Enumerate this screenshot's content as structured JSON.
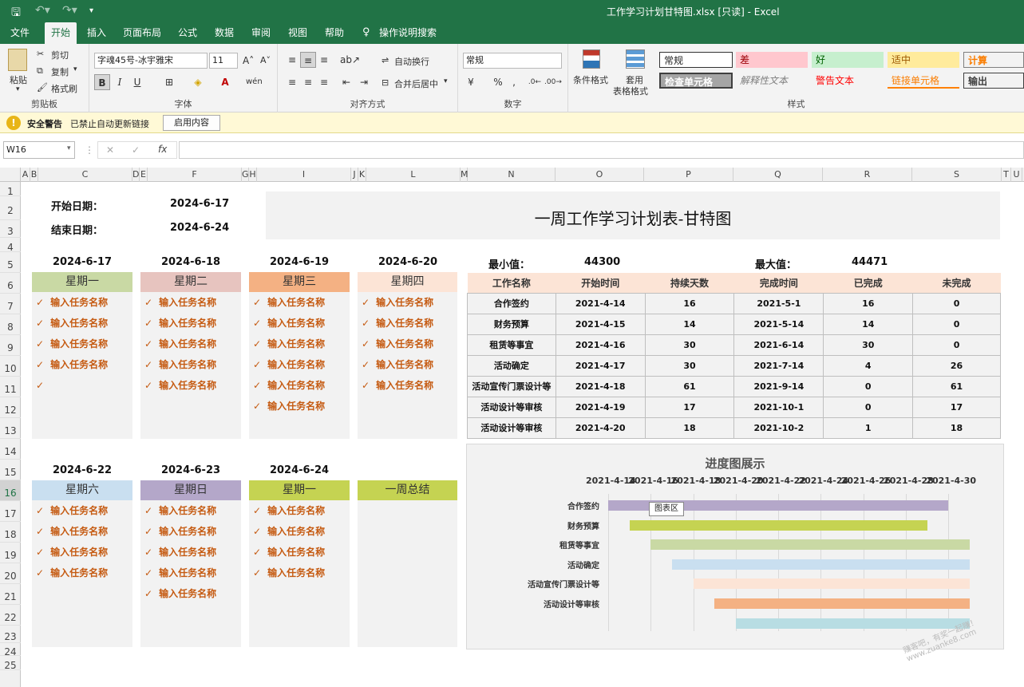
{
  "window": {
    "title": "工作学习计划甘特图.xlsx  [只读]  -  Excel"
  },
  "menu": {
    "tabs": [
      "文件",
      "开始",
      "插入",
      "页面布局",
      "公式",
      "数据",
      "审阅",
      "视图",
      "帮助",
      "操作说明搜索"
    ]
  },
  "ribbon": {
    "clipboard": {
      "paste": "粘贴",
      "cut": "剪切",
      "copy": "复制",
      "format_painter": "格式刷",
      "label": "剪贴板"
    },
    "font": {
      "name": "字魂45号-冰宇雅宋",
      "size": "11",
      "label": "字体"
    },
    "alignment": {
      "wrap": "自动换行",
      "merge": "合并后居中",
      "label": "对齐方式"
    },
    "number": {
      "format": "常规",
      "label": "数字"
    },
    "styles": {
      "conditional": "条件格式",
      "table_line1": "套用",
      "table_line2": "表格格式",
      "cells": [
        "常规",
        "差",
        "好",
        "适中",
        "计算",
        "检查单元格",
        "解释性文本",
        "警告文本",
        "链接单元格",
        "输出"
      ],
      "label": "样式"
    }
  },
  "warning": {
    "title": "安全警告",
    "message": "已禁止自动更新链接",
    "button": "启用内容"
  },
  "formula_bar": {
    "name_box": "W16",
    "fx": "fx",
    "x": "✕",
    "check": "✓"
  },
  "columns": [
    "A",
    "B",
    "C",
    "D",
    "E",
    "F",
    "G",
    "H",
    "I",
    "J",
    "K",
    "L",
    "M",
    "N",
    "O",
    "P",
    "Q",
    "R",
    "S",
    "T",
    "U"
  ],
  "rows": [
    "1",
    "2",
    "3",
    "4",
    "5",
    "6",
    "7",
    "8",
    "9",
    "10",
    "11",
    "12",
    "13",
    "14",
    "15",
    "16",
    "17",
    "18",
    "19",
    "20",
    "21",
    "22",
    "23",
    "24",
    "25"
  ],
  "sheet": {
    "start_label": "开始日期：",
    "start_date": "2024-6-17",
    "end_label": "结束日期：",
    "end_date": "2024-6-24",
    "title": "一周工作学习计划表-甘特图",
    "min_label": "最小值：",
    "min_value": "44300",
    "max_label": "最大值：",
    "max_value": "44471",
    "days_top": [
      {
        "date": "2024-6-17",
        "day": "星期一",
        "color": "#c9d9a4",
        "tasks": [
          "输入任务名称",
          "输入任务名称",
          "输入任务名称",
          "输入任务名称",
          ""
        ]
      },
      {
        "date": "2024-6-18",
        "day": "星期二",
        "color": "#e7c4bf",
        "tasks": [
          "输入任务名称",
          "输入任务名称",
          "输入任务名称",
          "输入任务名称",
          "输入任务名称"
        ]
      },
      {
        "date": "2024-6-19",
        "day": "星期三",
        "color": "#f4b183",
        "tasks": [
          "输入任务名称",
          "输入任务名称",
          "输入任务名称",
          "输入任务名称",
          "输入任务名称",
          "输入任务名称"
        ]
      },
      {
        "date": "2024-6-20",
        "day": "星期四",
        "color": "#fce4d6",
        "tasks": [
          "输入任务名称",
          "输入任务名称",
          "输入任务名称",
          "输入任务名称",
          "输入任务名称"
        ]
      }
    ],
    "days_bottom": [
      {
        "date": "2024-6-22",
        "day": "星期六",
        "color": "#c9dff0",
        "tasks": [
          "输入任务名称",
          "输入任务名称",
          "输入任务名称",
          "输入任务名称"
        ]
      },
      {
        "date": "2024-6-23",
        "day": "星期日",
        "color": "#b4a7c9",
        "tasks": [
          "输入任务名称",
          "输入任务名称",
          "输入任务名称",
          "输入任务名称",
          "输入任务名称"
        ]
      },
      {
        "date": "2024-6-24",
        "day": "星期一",
        "color": "#c5d352",
        "tasks": [
          "输入任务名称",
          "输入任务名称",
          "输入任务名称",
          "输入任务名称"
        ]
      },
      {
        "date": "",
        "day": "一周总结",
        "color": "#c5d352",
        "tasks": []
      }
    ],
    "table": {
      "headers": [
        "工作名称",
        "开始时间",
        "持续天数",
        "完成时间",
        "已完成",
        "未完成"
      ],
      "rows": [
        [
          "合作签约",
          "2021-4-14",
          "16",
          "2021-5-1",
          "16",
          "0"
        ],
        [
          "财务预算",
          "2021-4-15",
          "14",
          "2021-5-14",
          "14",
          "0"
        ],
        [
          "租赁等事宜",
          "2021-4-16",
          "30",
          "2021-6-14",
          "30",
          "0"
        ],
        [
          "活动确定",
          "2021-4-17",
          "30",
          "2021-7-14",
          "4",
          "26"
        ],
        [
          "活动宣传门票设计等",
          "2021-4-18",
          "61",
          "2021-9-14",
          "0",
          "61"
        ],
        [
          "活动设计等审核",
          "2021-4-19",
          "17",
          "2021-10-1",
          "0",
          "17"
        ],
        [
          "活动设计等审核",
          "2021-4-20",
          "18",
          "2021-10-2",
          "1",
          "18"
        ]
      ]
    }
  },
  "chart_data": {
    "type": "bar",
    "title": "进度图展示",
    "orientation": "horizontal",
    "x_ticks": [
      "2021-4-14",
      "2021-4-16",
      "2021-4-18",
      "2021-4-20",
      "2021-4-22",
      "2021-4-24",
      "2021-4-26",
      "2021-4-28",
      "2021-4-30"
    ],
    "xlim": [
      "2021-4-14",
      "2021-5-1"
    ],
    "categories": [
      "合作签约",
      "财务预算",
      "租赁等事宜",
      "活动确定",
      "活动宣传门票设计等",
      "活动设计等审核",
      ""
    ],
    "bars": [
      {
        "start": "2021-4-14",
        "end": "2021-4-30",
        "color": "#b4a7c9"
      },
      {
        "start": "2021-4-15",
        "end": "2021-4-29",
        "color": "#c5d352"
      },
      {
        "start": "2021-4-16",
        "end": "2021-5-1",
        "color": "#c9d9a4"
      },
      {
        "start": "2021-4-17",
        "end": "2021-5-1",
        "color": "#c9dff0"
      },
      {
        "start": "2021-4-18",
        "end": "2021-5-1",
        "color": "#fce4d6"
      },
      {
        "start": "2021-4-19",
        "end": "2021-5-1",
        "color": "#f4b183"
      },
      {
        "start": "2021-4-20",
        "end": "2021-5-1",
        "color": "#b8dde3"
      }
    ],
    "tooltip": "图表区",
    "grid": true
  }
}
